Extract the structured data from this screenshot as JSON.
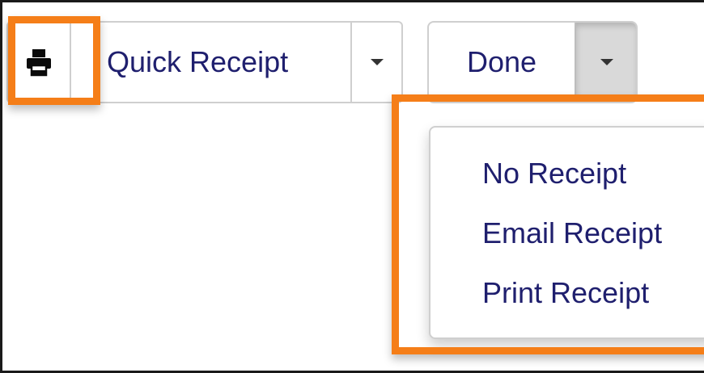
{
  "toolbar": {
    "print_icon": "printer-icon",
    "quick_receipt_label": "Quick Receipt",
    "done_label": "Done",
    "caret_icon": "caret-down-icon"
  },
  "dropdown": {
    "items": [
      {
        "label": "No Receipt"
      },
      {
        "label": "Email Receipt"
      },
      {
        "label": "Print Receipt"
      }
    ]
  },
  "colors": {
    "highlight": "#f57e18",
    "text": "#1f1f6e",
    "active_caret_bg": "#d9d9d9"
  }
}
